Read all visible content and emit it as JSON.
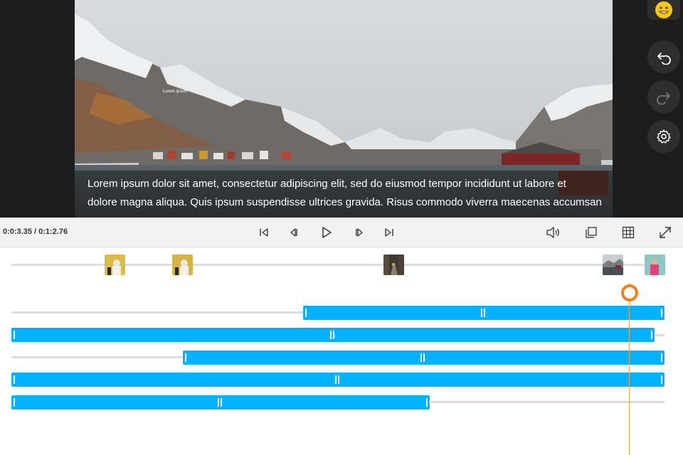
{
  "preview": {
    "overlay_label": "Lorem ipsum",
    "caption_line1": "Lorem ipsum dolor sit amet, consectetur adipiscing elit, sed do eiusmod tempor incididunt ut labore et",
    "caption_line2": "dolore magna aliqua. Quis ipsum suspendisse ultrices gravida. Risus commodo viverra maecenas accumsan"
  },
  "sidebar": {
    "buttons": [
      "emoji-sticker",
      "undo",
      "redo",
      "settings"
    ]
  },
  "controls": {
    "timecode": "0:0:3.35 / 0:1:2.76",
    "buttons": [
      "skip-to-start",
      "previous-frame",
      "play",
      "next-frame",
      "skip-to-end",
      "volume",
      "copy",
      "grid",
      "fullscreen"
    ]
  },
  "timeline": {
    "thumbnails": [
      "yellow-portrait",
      "yellow-portrait",
      "street-scene",
      "harbor-scene",
      "pink-portrait"
    ],
    "tracks": 5,
    "colors": {
      "clip": "#00b2ff",
      "playhead": "#f07f1d",
      "track": "#dddddd"
    }
  }
}
